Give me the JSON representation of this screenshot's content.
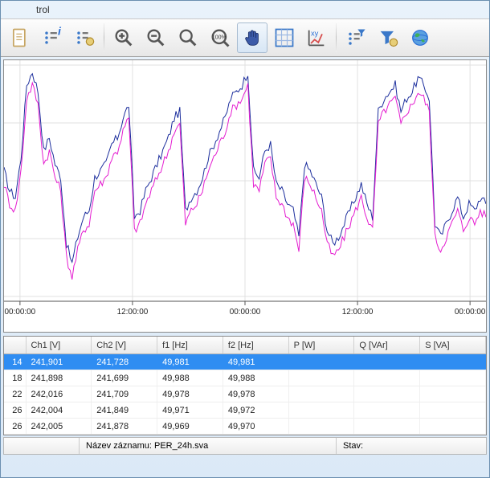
{
  "window": {
    "title_fragment": "trol"
  },
  "toolbar": {
    "icons": [
      "document",
      "info-list",
      "bullets-gear",
      "sep",
      "zoom-in",
      "zoom-out",
      "zoom",
      "zoom-100",
      "pan-hand",
      "grid-toggle",
      "xy-plot",
      "sep",
      "filter-list",
      "funnel-gear",
      "globe"
    ]
  },
  "chart_data": {
    "type": "line",
    "xlabel": "",
    "ylabel": "",
    "x_ticks": [
      "00:00:00",
      "12:00:00",
      "00:00:00",
      "12:00:00",
      "00:00:00"
    ],
    "ylim": [
      240.0,
      243.5
    ],
    "series": [
      {
        "name": "Ch1 [V]",
        "color": "#1b2d9c",
        "values": [
          241.9,
          241.6,
          241.5,
          242.1,
          243.2,
          243.4,
          243.1,
          242.2,
          242.4,
          242.0,
          241.8,
          240.8,
          240.5,
          240.9,
          241.2,
          241.3,
          241.8,
          241.9,
          242.0,
          242.3,
          242.4,
          242.7,
          242.9,
          241.2,
          241.3,
          241.6,
          241.8,
          242.0,
          242.2,
          242.4,
          242.7,
          242.8,
          241.3,
          241.5,
          241.6,
          241.8,
          242.1,
          242.3,
          242.5,
          242.7,
          243.0,
          243.1,
          243.2,
          243.4,
          241.9,
          241.8,
          242.2,
          242.3,
          241.7,
          241.6,
          241.4,
          241.3,
          240.9,
          242.0,
          241.9,
          241.7,
          241.5,
          241.0,
          240.8,
          240.9,
          241.1,
          241.3,
          241.5,
          241.7,
          241.4,
          241.2,
          242.8,
          243.0,
          243.1,
          243.2,
          242.8,
          243.0,
          243.1,
          243.3,
          243.2,
          243.0,
          241.1,
          240.9,
          241.1,
          241.3,
          241.5,
          241.2,
          241.4,
          241.3,
          241.5,
          241.4
        ]
      },
      {
        "name": "Ch2 [V]",
        "color": "#e41bd0",
        "values": [
          241.7,
          241.4,
          241.3,
          241.9,
          243.0,
          243.2,
          242.9,
          242.0,
          242.2,
          241.8,
          241.6,
          240.6,
          240.3,
          240.7,
          241.0,
          241.1,
          241.6,
          241.7,
          241.8,
          242.1,
          242.2,
          242.5,
          242.7,
          241.0,
          241.1,
          241.4,
          241.6,
          241.8,
          242.0,
          242.2,
          242.5,
          242.6,
          241.1,
          241.3,
          241.4,
          241.6,
          241.9,
          242.1,
          242.3,
          242.5,
          242.8,
          242.9,
          243.0,
          243.2,
          241.7,
          241.6,
          242.0,
          242.1,
          241.5,
          241.4,
          241.2,
          241.1,
          240.7,
          241.8,
          241.7,
          241.5,
          241.3,
          240.8,
          240.6,
          240.7,
          240.9,
          241.1,
          241.3,
          241.5,
          241.2,
          241.0,
          242.6,
          242.8,
          242.9,
          243.0,
          242.6,
          242.8,
          242.9,
          243.1,
          243.0,
          242.8,
          240.9,
          240.7,
          240.9,
          241.1,
          241.3,
          241.0,
          241.2,
          241.1,
          241.3,
          241.2
        ]
      }
    ]
  },
  "table": {
    "columns": [
      "",
      "Ch1 [V]",
      "Ch2 [V]",
      "f1 [Hz]",
      "f2 [Hz]",
      "P [W]",
      "Q [VAr]",
      "S [VA]"
    ],
    "rows": [
      {
        "id": "14",
        "cells": [
          "241,901",
          "241,728",
          "49,981",
          "49,981",
          "",
          "",
          ""
        ],
        "selected": true
      },
      {
        "id": "18",
        "cells": [
          "241,898",
          "241,699",
          "49,988",
          "49,988",
          "",
          "",
          ""
        ]
      },
      {
        "id": "22",
        "cells": [
          "242,016",
          "241,709",
          "49,978",
          "49,978",
          "",
          "",
          ""
        ]
      },
      {
        "id": "26",
        "cells": [
          "242,004",
          "241,849",
          "49,971",
          "49,972",
          "",
          "",
          ""
        ]
      },
      {
        "id": "26",
        "cells": [
          "242,005",
          "241,878",
          "49,969",
          "49,970",
          "",
          "",
          ""
        ]
      }
    ]
  },
  "status": {
    "record_label": "Název záznamu:",
    "record_value": "PER_24h.sva",
    "state_label": "Stav:",
    "state_value": ""
  }
}
